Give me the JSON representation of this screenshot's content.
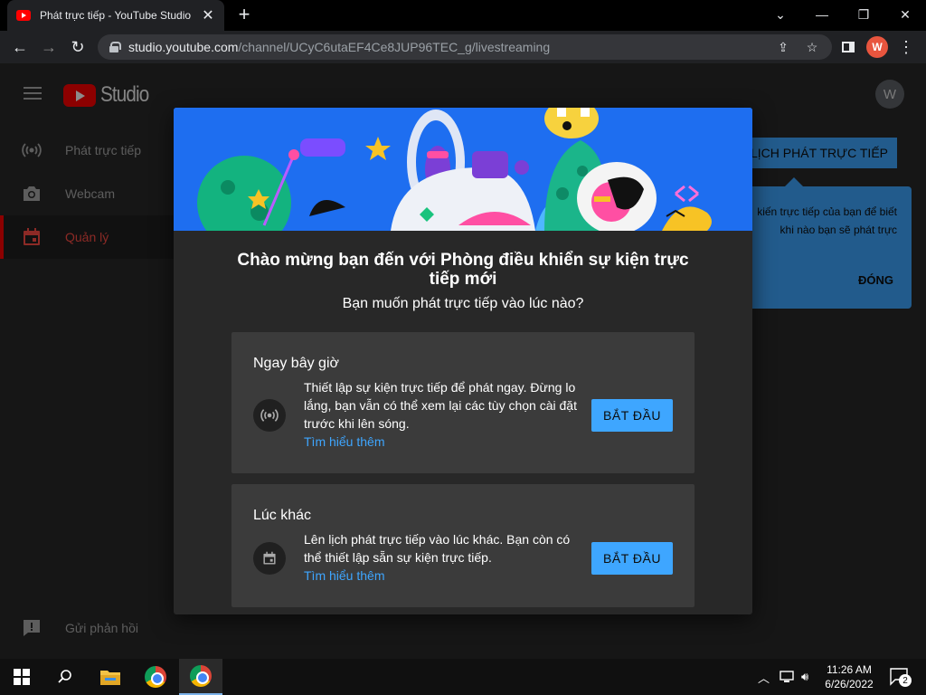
{
  "browser": {
    "tab_title": "Phát trực tiếp - YouTube Studio",
    "url_host": "studio.youtube.com",
    "url_path": "/channel/UCyC6utaEF4Ce8JUP96TEC_g/livestreaming",
    "profile_initial": "W"
  },
  "studio": {
    "logo_text": "Studio",
    "avatar_initial": "W",
    "sidebar": [
      {
        "label": "Phát trực tiếp",
        "icon": "broadcast-icon"
      },
      {
        "label": "Webcam",
        "icon": "camera-icon"
      },
      {
        "label": "Quản lý",
        "icon": "calendar-icon",
        "active": true
      }
    ],
    "feedback_label": "Gửi phản hồi",
    "schedule_button": "LÊN LỊCH PHÁT TRỰC TIẾP",
    "tooltip_text": "kiến trực tiếp của bạn để biết khi nào bạn sẽ phát trực",
    "tooltip_close": "ĐÓNG"
  },
  "modal": {
    "title": "Chào mừng bạn đến với Phòng điều khiển sự kiện trực tiếp mới",
    "subtitle": "Bạn muốn phát trực tiếp vào lúc nào?",
    "options": [
      {
        "heading": "Ngay bây giờ",
        "description": "Thiết lập sự kiện trực tiếp để phát ngay. Đừng lo lắng, bạn vẫn có thể xem lại các tùy chọn cài đặt trước khi lên sóng.",
        "link": "Tìm hiểu thêm",
        "button": "BẮT ĐẦU",
        "icon": "broadcast-icon"
      },
      {
        "heading": "Lúc khác",
        "description": "Lên lịch phát trực tiếp vào lúc khác. Bạn còn có thể thiết lập sẵn sự kiện trực tiếp.",
        "link": "Tìm hiểu thêm",
        "button": "BẮT ĐẦU",
        "icon": "calendar-icon"
      }
    ]
  },
  "taskbar": {
    "time": "11:26 AM",
    "date": "6/26/2022",
    "notification_count": "2"
  },
  "colors": {
    "accent": "#3ea6ff",
    "brand_red": "#ff0000",
    "hero_blue": "#1e6ef0"
  }
}
